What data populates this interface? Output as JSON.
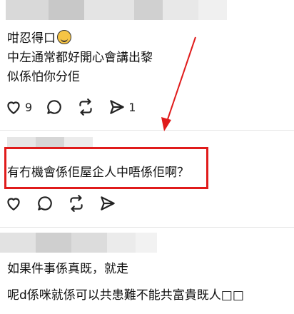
{
  "post1": {
    "lines": [
      "咁忍得口",
      "中左通常都好開心會講出黎",
      "似係怕你分佢"
    ],
    "likes": "9",
    "shares": "1"
  },
  "post2": {
    "text": "有冇機會係佢屋企人中唔係佢啊？"
  },
  "post3": {
    "lines": [
      "如果件事係真既，就走",
      "呢d係咪就係可以共患難不能共富貴既人□□"
    ]
  },
  "icons": [
    "heart-icon",
    "comment-icon",
    "repost-icon",
    "send-icon",
    "laughing-emoji-icon"
  ],
  "colors": {
    "highlight": "#e01b1b",
    "arrow": "#e01b1b"
  }
}
